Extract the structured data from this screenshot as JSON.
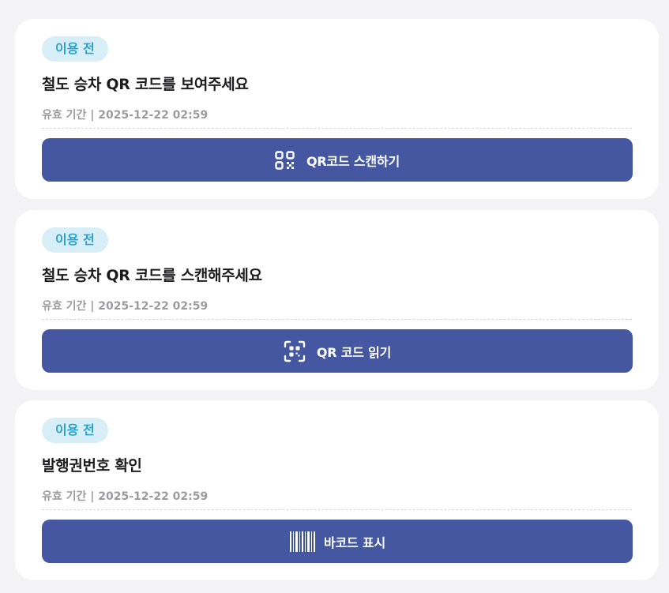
{
  "cards": [
    {
      "badge": "이용 전",
      "title": "철도 승차 QR 코드를 보여주세요",
      "validity": "유효 기간 | 2025-12-22 02:59",
      "button_label": "QR코드 스캔하기",
      "button_icon": "qr-code-icon"
    },
    {
      "badge": "이용 전",
      "title": "철도 승차 QR 코드를 스캔해주세요",
      "validity": "유효 기간 | 2025-12-22 02:59",
      "button_label": "QR 코드 읽기",
      "button_icon": "qr-scan-icon"
    },
    {
      "badge": "이용 전",
      "title": "발행권번호 확인",
      "validity": "유효 기간 | 2025-12-22 02:59",
      "button_label": "바코드 표시",
      "button_icon": "barcode-icon"
    }
  ],
  "colors": {
    "background": "#f3f3f5",
    "card": "#ffffff",
    "badge_bg": "#d7eef7",
    "badge_text": "#2aa3cf",
    "button": "#4457a0",
    "muted_text": "#9a9aa0"
  }
}
